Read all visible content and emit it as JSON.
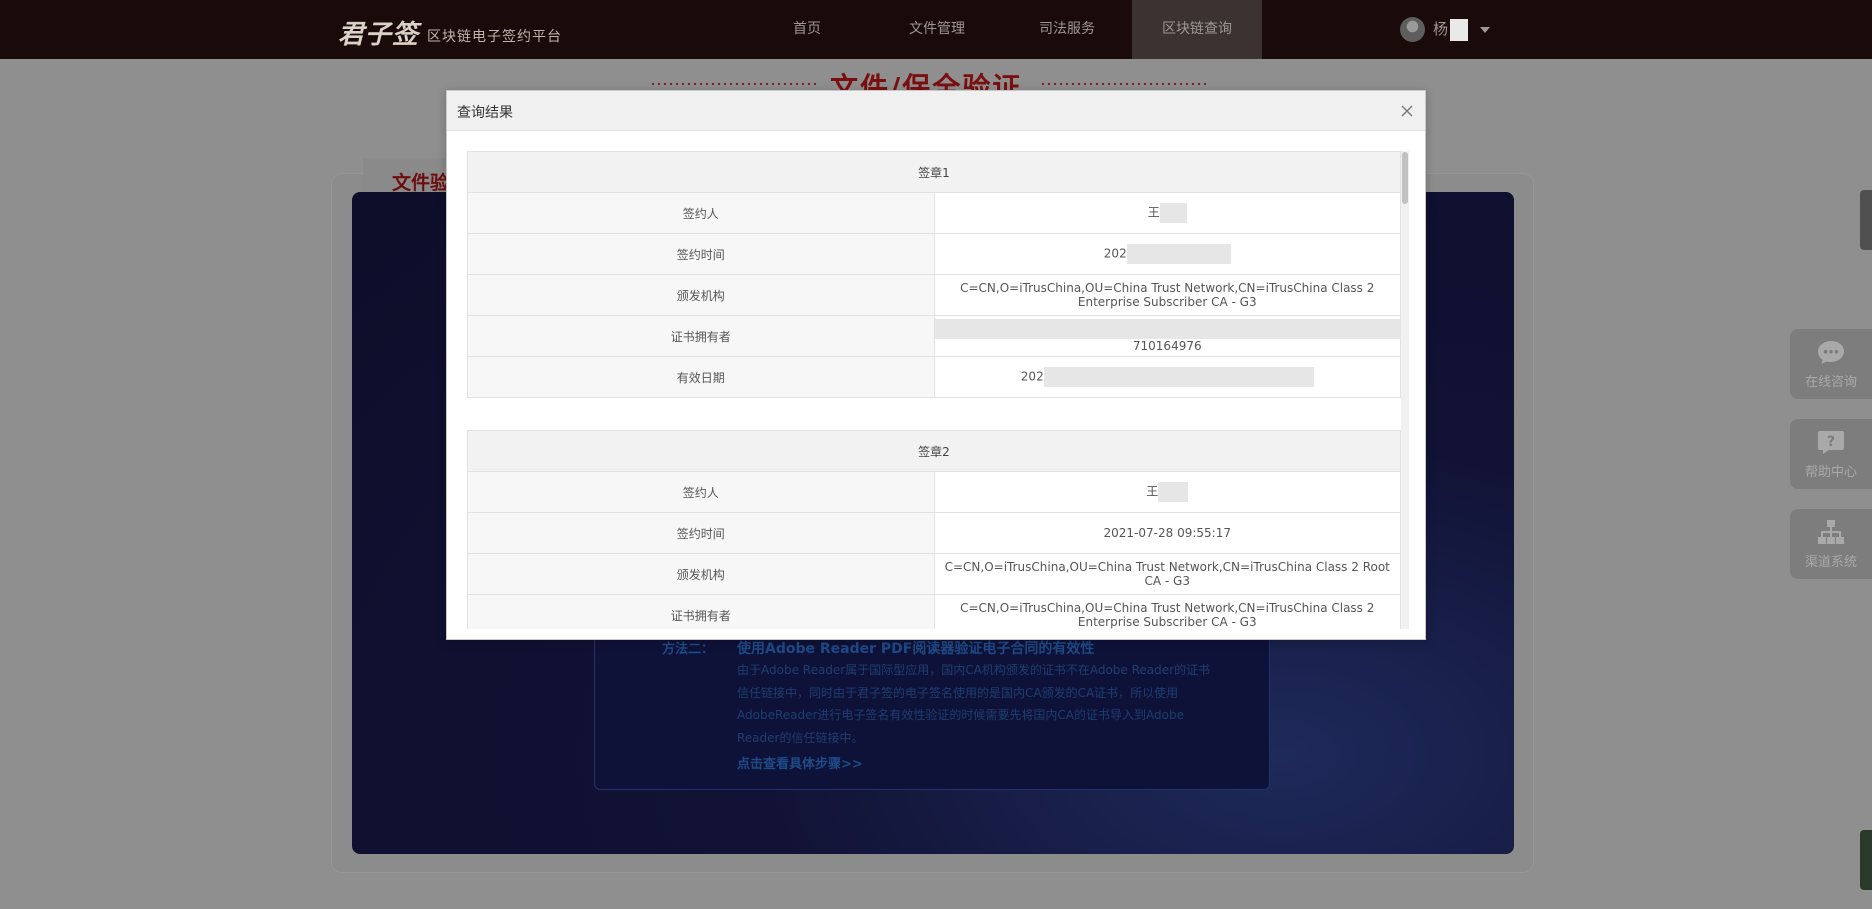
{
  "topbar": {
    "logo_mark": "君子签",
    "logo_sub": "区块链电子签约平台",
    "nav": [
      "首页",
      "文件管理",
      "司法服务",
      "区块链查询"
    ],
    "active_nav": "区块链查询",
    "user_name": "杨"
  },
  "background_page": {
    "title": "文件/保全验证",
    "tab_label": "文件验",
    "method_tag": "方法二：",
    "method_title": "使用Adobe Reader PDF阅读器验证电子合同的有效性",
    "method_desc": "由于Adobe Reader属于国际型应用，国内CA机构颁发的证书不在Adobe Reader的证书信任链接中，同时由于君子签的电子签名使用的是国内CA颁发的CA证书，所以使用AdobeReader进行电子签名有效性验证的时候需要先将国内CA的证书导入到Adobe Reader的信任链接中。",
    "method_link": "点击查看具体步骤>>"
  },
  "float_tools": [
    {
      "label": "在线咨询",
      "icon": "chat-icon"
    },
    {
      "label": "帮助中心",
      "icon": "help-icon"
    },
    {
      "label": "渠道系统",
      "icon": "network-icon"
    }
  ],
  "modal": {
    "title": "查询结果",
    "close_icon": "close-icon",
    "signatures": [
      {
        "heading": "签章1",
        "rows": [
          {
            "key": "签约人",
            "value": "王"
          },
          {
            "key": "签约时间",
            "value": "202"
          },
          {
            "key": "颁发机构",
            "value": "C=CN,O=iTrusChina,OU=China Trust Network,CN=iTrusChina Class 2 Enterprise Subscriber CA - G3"
          },
          {
            "key": "证书拥有者",
            "value": "710164976"
          },
          {
            "key": "有效日期",
            "value": "202"
          }
        ]
      },
      {
        "heading": "签章2",
        "rows": [
          {
            "key": "签约人",
            "value": "王"
          },
          {
            "key": "签约时间",
            "value": "2021-07-28 09:55:17"
          },
          {
            "key": "颁发机构",
            "value": "C=CN,O=iTrusChina,OU=China Trust Network,CN=iTrusChina Class 2 Root CA - G3"
          },
          {
            "key": "证书拥有者",
            "value": "C=CN,O=iTrusChina,OU=China Trust Network,CN=iTrusChina Class 2 Enterprise Subscriber CA - G3"
          }
        ]
      }
    ]
  }
}
